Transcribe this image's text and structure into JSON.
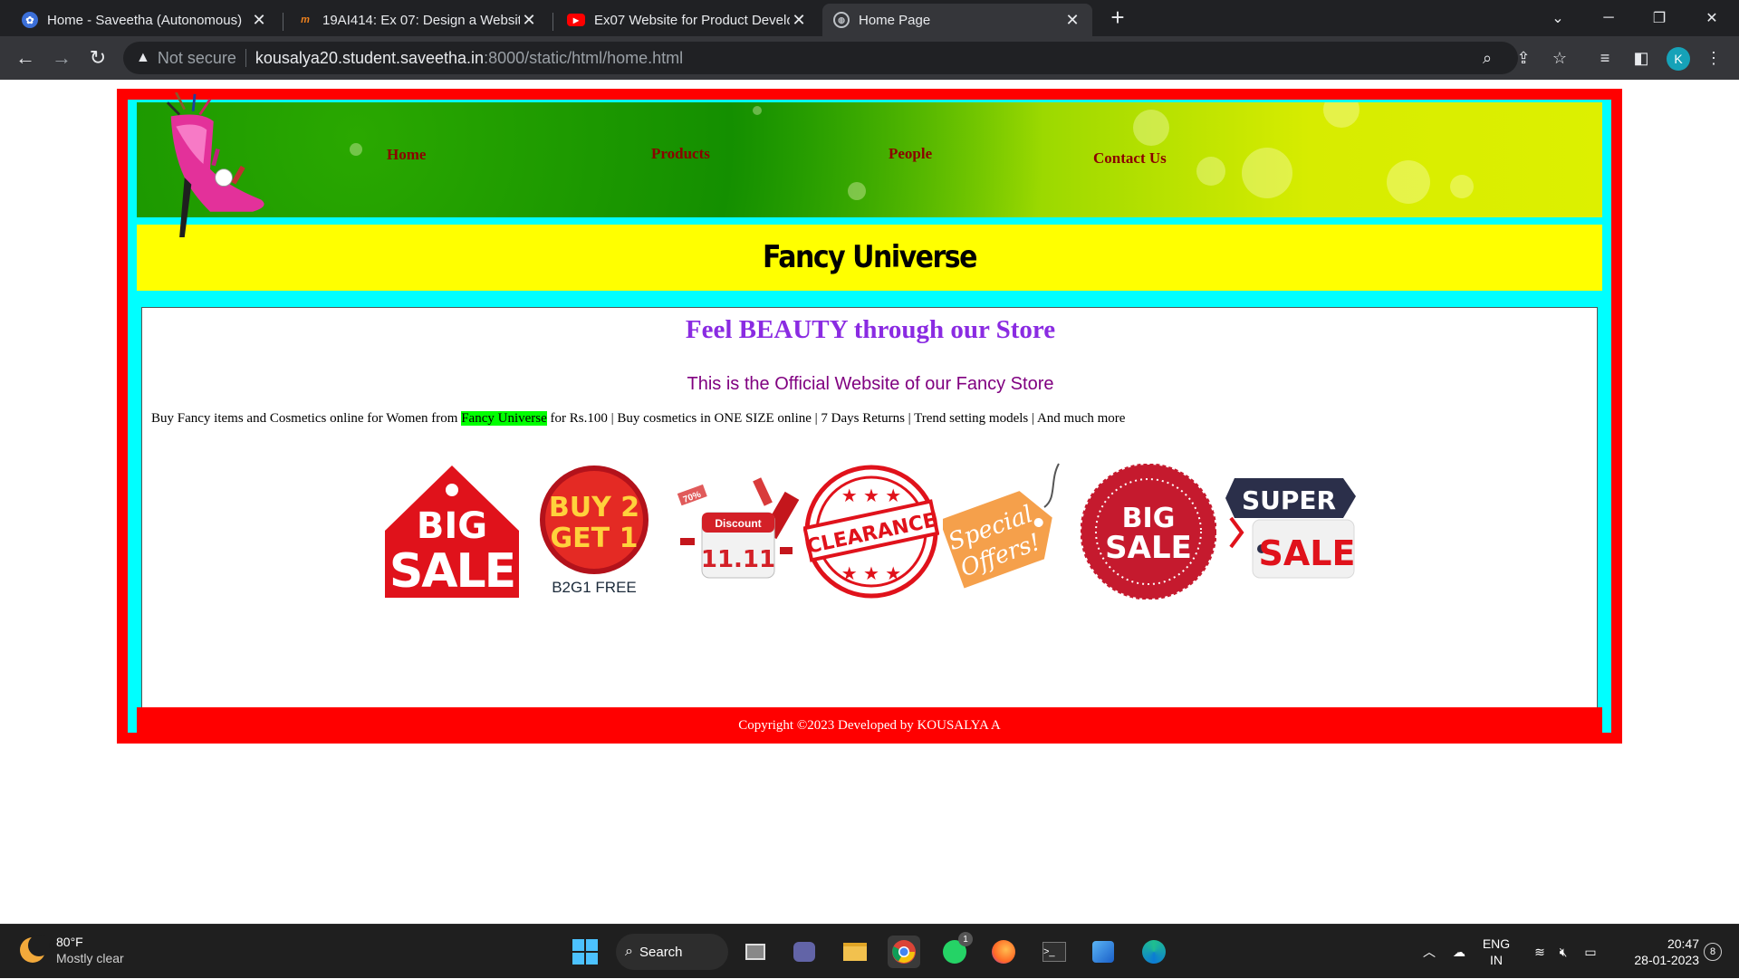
{
  "browser": {
    "tabs": [
      {
        "title": "Home - Saveetha (Autonomous)",
        "active": false
      },
      {
        "title": "19AI414: Ex 07: Design a Website",
        "active": false
      },
      {
        "title": "Ex07 Website for Product Develo",
        "active": false
      },
      {
        "title": "Home Page",
        "active": true
      }
    ],
    "security_label": "Not secure",
    "url_host": "kousalya20.student.saveetha.in",
    "url_path": ":8000/static/html/home.html",
    "profile_initial": "K"
  },
  "site": {
    "menu": [
      "Home",
      "Products",
      "People",
      "Contact Us"
    ],
    "brand": "Fancy Universe",
    "headline": "Feel BEAUTY through our Store",
    "subline": "This is the Official Website of our Fancy Store",
    "body": {
      "before": "Buy Fancy items and Cosmetics online for Women from ",
      "highlight": "Fancy Universe",
      "after": " for Rs.100 | Buy cosmetics in ONE SIZE online | 7 Days Returns | Trend setting models | And much more"
    },
    "badges": {
      "big_sale_1": [
        "BIG",
        "SALE"
      ],
      "buy2get1": [
        "BUY 2",
        "GET 1",
        "B2G1 FREE"
      ],
      "discount": [
        "70%",
        "Discount",
        "11.11"
      ],
      "clearance": "CLEARANCE",
      "special_offers": [
        "Special",
        "Offers!"
      ],
      "big_sale_2": [
        "BIG",
        "SALE"
      ],
      "super_sale": [
        "SUPER",
        "SALE"
      ]
    },
    "footer": "Copyright ©2023 Developed by KOUSALYA A"
  },
  "taskbar": {
    "temp": "80°F",
    "condition": "Mostly clear",
    "search_label": "Search",
    "lang_top": "ENG",
    "lang_bottom": "IN",
    "time": "20:47",
    "date": "28-01-2023",
    "whatsapp_badge": "1",
    "notif_count": "8"
  },
  "colors": {
    "frame_red": "#ff0000",
    "frame_cyan": "#00ffff",
    "brand_yellow": "#ffff00",
    "menu_text": "#8b0000",
    "headline": "#8a2be2",
    "subline": "#800080",
    "highlight": "#00ff00"
  }
}
